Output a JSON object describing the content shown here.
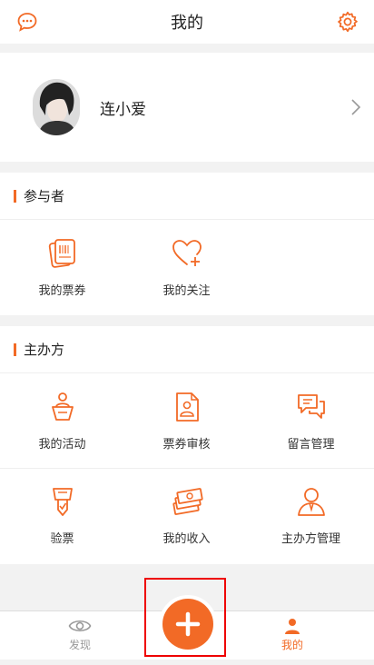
{
  "header": {
    "title": "我的"
  },
  "profile": {
    "name": "连小爱"
  },
  "participant": {
    "title": "参与者",
    "items": [
      {
        "label": "我的票券",
        "icon": "ticket-icon"
      },
      {
        "label": "我的关注",
        "icon": "heart-plus-icon"
      }
    ]
  },
  "organizer": {
    "title": "主办方",
    "items": [
      {
        "label": "我的活动",
        "icon": "person-podium-icon"
      },
      {
        "label": "票券审核",
        "icon": "document-person-icon"
      },
      {
        "label": "留言管理",
        "icon": "chat-bubbles-icon"
      },
      {
        "label": "验票",
        "icon": "ticket-check-icon"
      },
      {
        "label": "我的收入",
        "icon": "money-icon"
      },
      {
        "label": "主办方管理",
        "icon": "organizer-icon"
      }
    ]
  },
  "tabbar": {
    "discover": "发现",
    "mine": "我的"
  },
  "colors": {
    "accent": "#f26a26"
  }
}
